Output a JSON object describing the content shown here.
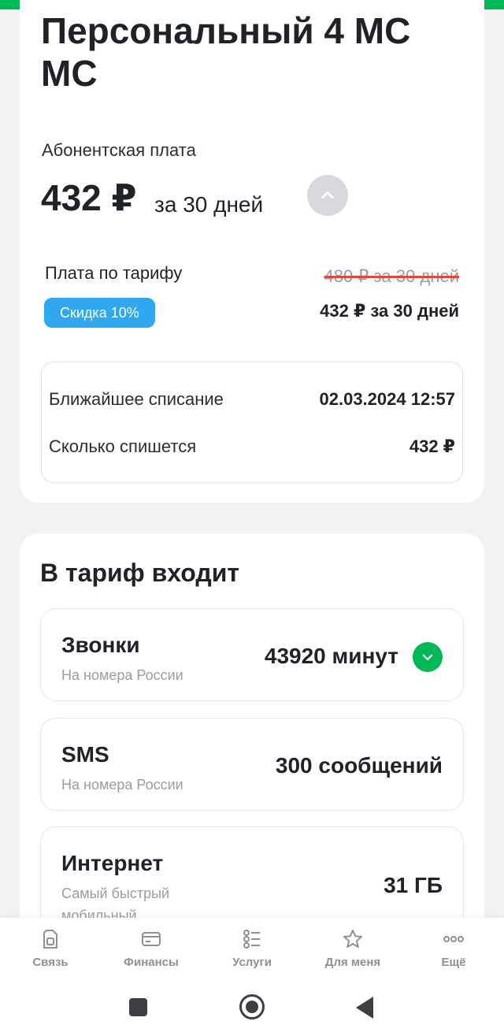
{
  "tariff": {
    "name": "Персональный 4 МС МС",
    "fee_title": "Абонентская плата",
    "fee_amount": "432 ₽",
    "fee_period": "за 30 дней",
    "plan_label": "Плата по тарифу",
    "old_price": "480 ₽ за 30 дней",
    "discount": "Скидка 10%",
    "new_price": "432 ₽ за 30 дней",
    "next_charge_label": "Ближайшее списание",
    "next_charge_value": "02.03.2024 12:57",
    "charge_amount_label": "Сколько спишется",
    "charge_amount_value": "432 ₽"
  },
  "includes": {
    "title": "В тариф входит",
    "items": [
      {
        "title": "Звонки",
        "subtitle": "На номера России",
        "value": "43920 минут",
        "icon": "chevron-down-icon"
      },
      {
        "title": "SMS",
        "subtitle": "На номера России",
        "value": "300 сообщений"
      },
      {
        "title": "Интернет",
        "subtitle": "Самый быстрый мобильный",
        "value": "31 ГБ"
      }
    ]
  },
  "nav": {
    "items": [
      {
        "label": "Связь",
        "icon": "sim-icon"
      },
      {
        "label": "Финансы",
        "icon": "card-icon"
      },
      {
        "label": "Услуги",
        "icon": "list-icon"
      },
      {
        "label": "Для меня",
        "icon": "star-icon"
      },
      {
        "label": "Ещё",
        "icon": "more-icon"
      }
    ]
  },
  "colors": {
    "brand": "#00b956",
    "discount": "#2fa8f0",
    "strike": "#e0483d"
  }
}
